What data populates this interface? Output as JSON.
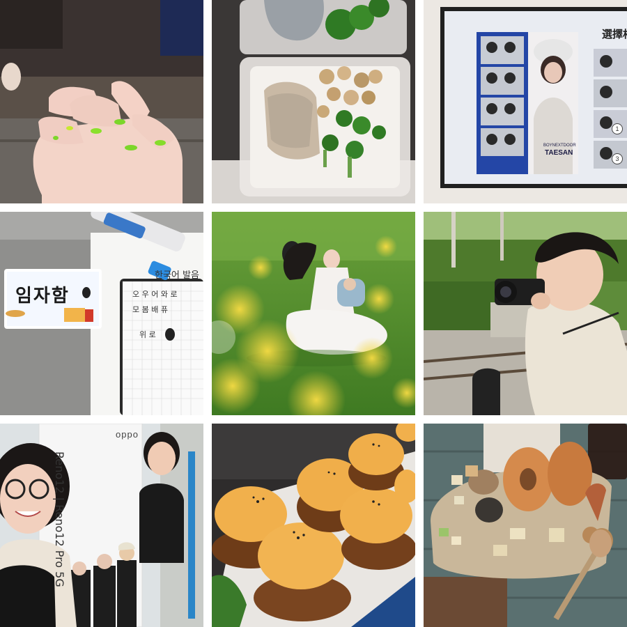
{
  "collage": {
    "tiles": [
      {
        "subject": "hand-with-green-nails"
      },
      {
        "subject": "salmon-broccoli-mushroom-meal-box"
      },
      {
        "subject": "photo-booth-kiosk-screen"
      },
      {
        "subject": "korean-name-card-notebook"
      },
      {
        "subject": "woman-in-white-dress-flower-field"
      },
      {
        "subject": "boy-with-camera-by-railway"
      },
      {
        "subject": "selfie-with-phone-promo-poster"
      },
      {
        "subject": "cream-topped-pastries"
      },
      {
        "subject": "bagel-charcuterie-basket"
      }
    ]
  },
  "korean_card": {
    "name": "임자함"
  },
  "notebook": {
    "heading": "한국어 발음",
    "line1": "오 우 어 와 로",
    "line2": "모 봄 배 퓨",
    "line3": "위 로"
  },
  "kiosk": {
    "title": "選擇相",
    "group": "BOYNEXTDOOR",
    "name": "TAESAN",
    "num1": "1",
    "num3": "3"
  },
  "poster": {
    "brand": "oppo",
    "text": "Reno12 | Reno12 Pro 5G"
  },
  "colors": {
    "nail_green": "#7cd62a",
    "grass": "#4e8a2a",
    "flower_yellow": "#f2d43a",
    "cream": "#f1b04c",
    "kiosk_blue": "#2446a6"
  }
}
